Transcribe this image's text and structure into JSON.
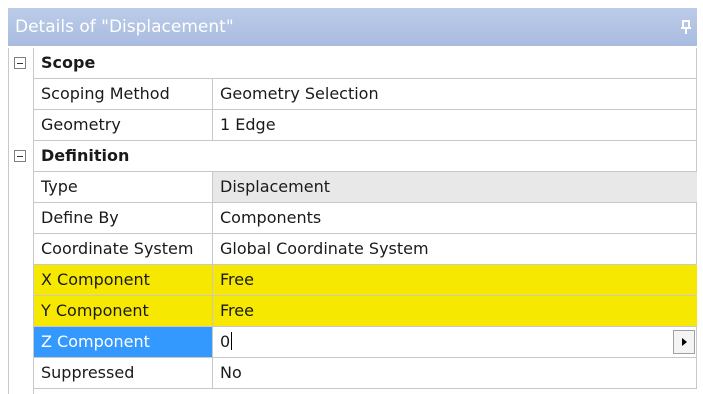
{
  "panel": {
    "title": "Details of \"Displacement\""
  },
  "scope": {
    "header": "Scope",
    "rows": [
      {
        "label": "Scoping Method",
        "value": "Geometry Selection"
      },
      {
        "label": "Geometry",
        "value": "1 Edge"
      }
    ]
  },
  "definition": {
    "header": "Definition",
    "type": {
      "label": "Type",
      "value": "Displacement"
    },
    "define_by": {
      "label": "Define By",
      "value": "Components"
    },
    "coordinate_system": {
      "label": "Coordinate System",
      "value": "Global Coordinate System"
    },
    "x_component": {
      "label": "X Component",
      "value": "Free"
    },
    "y_component": {
      "label": "Y Component",
      "value": "Free"
    },
    "z_component": {
      "label": "Z Component",
      "value": "0"
    },
    "suppressed": {
      "label": "Suppressed",
      "value": "No"
    }
  },
  "colors": {
    "title_bar": "#a9bce0",
    "highlight": "#f6e800",
    "selection": "#3399ff",
    "readonly_cell": "#e8e8e8"
  },
  "icons": {
    "pin": "pin-icon",
    "collapse": "collapse-minus-icon",
    "dropdown": "dropdown-arrow-icon"
  }
}
